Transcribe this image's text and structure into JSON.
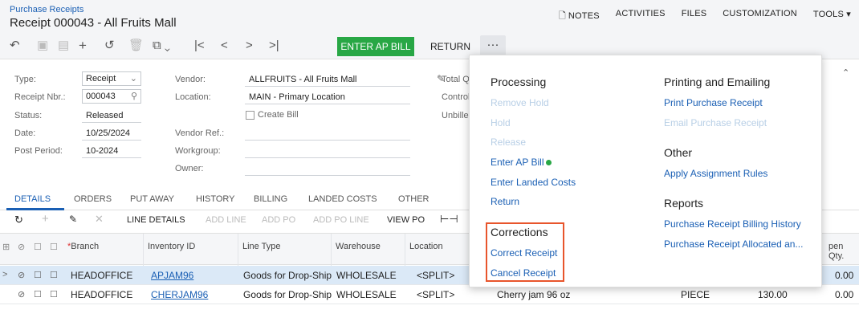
{
  "header": {
    "breadcrumb": "Purchase Receipts",
    "title": "Receipt 000043 - All Fruits Mall",
    "links": {
      "notes": "NOTES",
      "activities": "ACTIVITIES",
      "files": "FILES",
      "customization": "CUSTOMIZATION",
      "tools": "TOOLS ▾"
    }
  },
  "toolbar": {
    "enter_ap_bill": "ENTER AP BILL",
    "return": "RETURN",
    "more": "···"
  },
  "form": {
    "type_label": "Type:",
    "type_value": "Receipt",
    "receipt_nbr_label": "Receipt Nbr.:",
    "receipt_nbr_value": "000043",
    "status_label": "Status:",
    "status_value": "Released",
    "date_label": "Date:",
    "date_value": "10/25/2024",
    "post_period_label": "Post Period:",
    "post_period_value": "10-2024",
    "vendor_label": "Vendor:",
    "vendor_value": "ALLFRUITS - All Fruits Mall",
    "location_label": "Location:",
    "location_value": "MAIN - Primary Location",
    "create_bill_label": "Create Bill",
    "vendor_ref_label": "Vendor Ref.:",
    "workgroup_label": "Workgroup:",
    "owner_label": "Owner:",
    "total_q_label": "Total Q",
    "control_label": "Control",
    "unbilled_label": "Unbille"
  },
  "tabs": [
    "DETAILS",
    "ORDERS",
    "PUT AWAY",
    "HISTORY",
    "BILLING",
    "LANDED COSTS",
    "OTHER"
  ],
  "grid_toolbar": {
    "line_details": "LINE DETAILS",
    "add_line": "ADD LINE",
    "add_po": "ADD PO",
    "add_po_line": "ADD PO LINE",
    "view_po": "VIEW PO"
  },
  "grid": {
    "headers": {
      "branch": "Branch",
      "inventory_id": "Inventory ID",
      "line_type": "Line Type",
      "warehouse": "Warehouse",
      "location": "Location",
      "open_qty": "pen Qty."
    },
    "rows": [
      {
        "branch": "HEADOFFICE",
        "inventory_id": "APJAM96",
        "line_type": "Goods for Drop-Ship",
        "warehouse": "WHOLESALE",
        "location": "<SPLIT>",
        "description": "",
        "uom": "",
        "qty": "",
        "open_qty": "0.00"
      },
      {
        "branch": "HEADOFFICE",
        "inventory_id": "CHERJAM96",
        "line_type": "Goods for Drop-Ship",
        "warehouse": "WHOLESALE",
        "location": "<SPLIT>",
        "description": "Cherry jam 96 oz",
        "uom": "PIECE",
        "qty": "130.00",
        "open_qty": "0.00"
      }
    ]
  },
  "menu": {
    "processing": {
      "heading": "Processing",
      "remove_hold": "Remove Hold",
      "hold": "Hold",
      "release": "Release",
      "enter_ap_bill": "Enter AP Bill",
      "enter_landed_costs": "Enter Landed Costs",
      "return": "Return"
    },
    "corrections": {
      "heading": "Corrections",
      "correct_receipt": "Correct Receipt",
      "cancel_receipt": "Cancel Receipt"
    },
    "printing": {
      "heading": "Printing and Emailing",
      "print_receipt": "Print Purchase Receipt",
      "email_receipt": "Email Purchase Receipt"
    },
    "other": {
      "heading": "Other",
      "apply_rules": "Apply Assignment Rules"
    },
    "reports": {
      "heading": "Reports",
      "billing_history": "Purchase Receipt Billing History",
      "allocated": "Purchase Receipt Allocated an..."
    }
  },
  "colors": {
    "accent": "#1a5fb4",
    "success": "#28a745",
    "highlight": "#e8552c"
  }
}
